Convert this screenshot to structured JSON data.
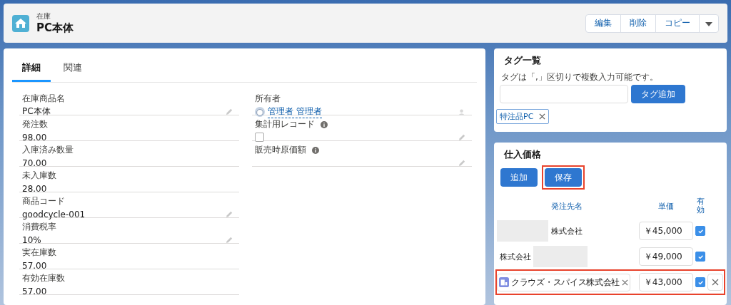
{
  "header": {
    "object_type": "在庫",
    "title": "PC本体",
    "actions": [
      "編集",
      "削除",
      "コピー"
    ]
  },
  "tabs": [
    {
      "label": "詳細",
      "selected": true
    },
    {
      "label": "関連",
      "selected": false
    }
  ],
  "left_fields": [
    {
      "label": "在庫商品名",
      "value": "PC本体",
      "editable": true
    },
    {
      "label": "発注数",
      "value": "98.00",
      "editable": false
    },
    {
      "label": "入庫済み数量",
      "value": "70.00",
      "editable": false
    },
    {
      "label": "未入庫数",
      "value": "28.00",
      "editable": false
    },
    {
      "label": "商品コード",
      "value": "goodcycle-001",
      "editable": true
    },
    {
      "label": "消費税率",
      "value": "10%",
      "editable": true
    },
    {
      "label": "実在庫数",
      "value": "57.00",
      "editable": false
    },
    {
      "label": "有効在庫数",
      "value": "57.00",
      "editable": false
    }
  ],
  "right_fields": [
    {
      "kind": "owner",
      "label": "所有者",
      "value": "管理者 管理者"
    },
    {
      "kind": "checkbox",
      "label": "集計用レコード",
      "info": true,
      "checked": false
    },
    {
      "kind": "text",
      "label": "販売時原価額",
      "info": true
    }
  ],
  "tag_card": {
    "title": "タグ一覧",
    "hint": "タグは「,」区切りで複数入力可能です。",
    "add_button": "タグ追加",
    "tags": [
      "特注品PC"
    ]
  },
  "price_card": {
    "title": "仕入価格",
    "buttons": [
      {
        "label": "追加",
        "highlighted": false
      },
      {
        "label": "保存",
        "highlighted": true
      }
    ],
    "columns": [
      "発注先名",
      "単価",
      "有効"
    ],
    "rows": [
      {
        "kind": "text",
        "supplier": "株式会社",
        "redacted_before": true,
        "redacted_after": false,
        "price": "￥45,000",
        "checked": true,
        "highlighted": false
      },
      {
        "kind": "text",
        "supplier": "株式会社",
        "redacted_before": false,
        "redacted_after": true,
        "price": "￥49,000",
        "checked": true,
        "highlighted": false
      },
      {
        "kind": "lookup",
        "supplier": "クラウズ・スパイス株式会社",
        "price": "￥43,000",
        "checked": true,
        "highlighted": true
      }
    ]
  }
}
